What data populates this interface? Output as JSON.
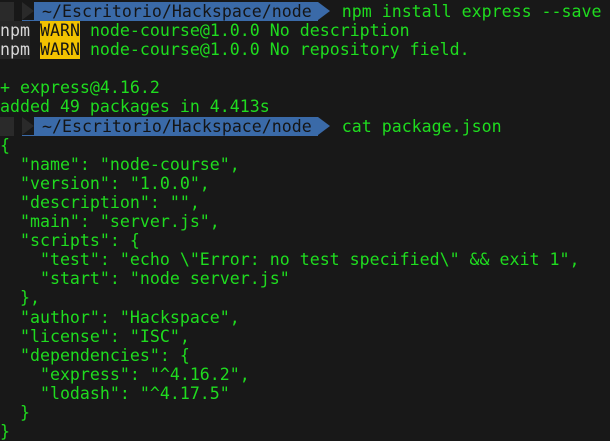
{
  "prompt_path": "~/Escritorio/Hackspace/node",
  "commands": [
    "npm install express --save",
    "cat package.json"
  ],
  "warnings": [
    {
      "prefix": "npm",
      "level": "WARN",
      "message": " node-course@1.0.0 No description"
    },
    {
      "prefix": "npm",
      "level": "WARN",
      "message": " node-course@1.0.0 No repository field."
    }
  ],
  "install_output": [
    "",
    "+ express@4.16.2",
    "added 49 packages in 4.413s"
  ],
  "json_output": [
    "{",
    "  \"name\": \"node-course\",",
    "  \"version\": \"1.0.0\",",
    "  \"description\": \"\",",
    "  \"main\": \"server.js\",",
    "  \"scripts\": {",
    "    \"test\": \"echo \\\"Error: no test specified\\\" && exit 1\",",
    "    \"start\": \"node server.js\"",
    "  },",
    "  \"author\": \"Hackspace\",",
    "  \"license\": \"ISC\",",
    "  \"dependencies\": {",
    "    \"express\": \"^4.16.2\",",
    "    \"lodash\": \"^4.17.5\"",
    "  }",
    "}"
  ]
}
